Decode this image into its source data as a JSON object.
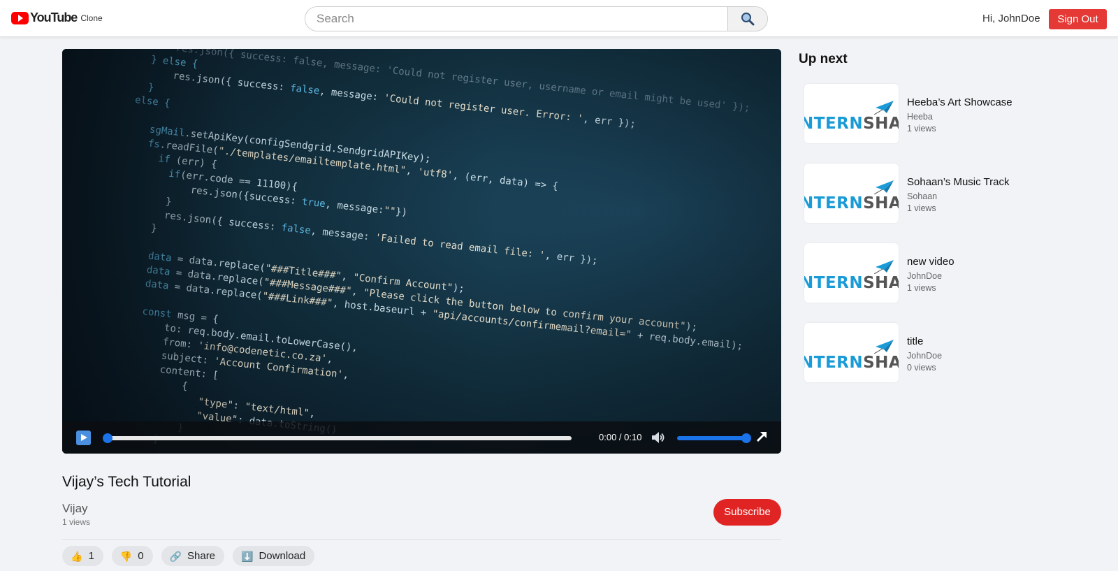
{
  "header": {
    "logo_text": "YouTube",
    "logo_suffix": "Clone",
    "search_placeholder": "Search",
    "greeting": "Hi, JohnDoe",
    "signout_label": "Sign Out"
  },
  "player": {
    "time": "0:00 / 0:10",
    "progress": 0,
    "volume": 1
  },
  "video": {
    "title": "Vijay’s Tech Tutorial",
    "channel": "Vijay",
    "views": "1 views",
    "subscribe_label": "Subscribe"
  },
  "actions": {
    "like_count": "1",
    "dislike_count": "0",
    "share_label": "Share",
    "download_label": "Download"
  },
  "sidebar": {
    "heading": "Up next",
    "thumb_brand": {
      "left": "NTERN",
      "right": "SHAL"
    },
    "items": [
      {
        "title": "Heeba’s Art Showcase",
        "channel": "Heeba",
        "views": "1 views"
      },
      {
        "title": "Sohaan’s Music Track",
        "channel": "Sohaan",
        "views": "1 views"
      },
      {
        "title": "new video",
        "channel": "JohnDoe",
        "views": "1 views"
      },
      {
        "title": "title",
        "channel": "JohnDoe",
        "views": "0 views"
      }
    ]
  },
  "colors": {
    "brand_red": "#ff0000",
    "signout": "#e53935",
    "subscribe": "#e02424",
    "accent_blue": "#1a73e8",
    "thumb_blue": "#1a9bd7"
  }
}
